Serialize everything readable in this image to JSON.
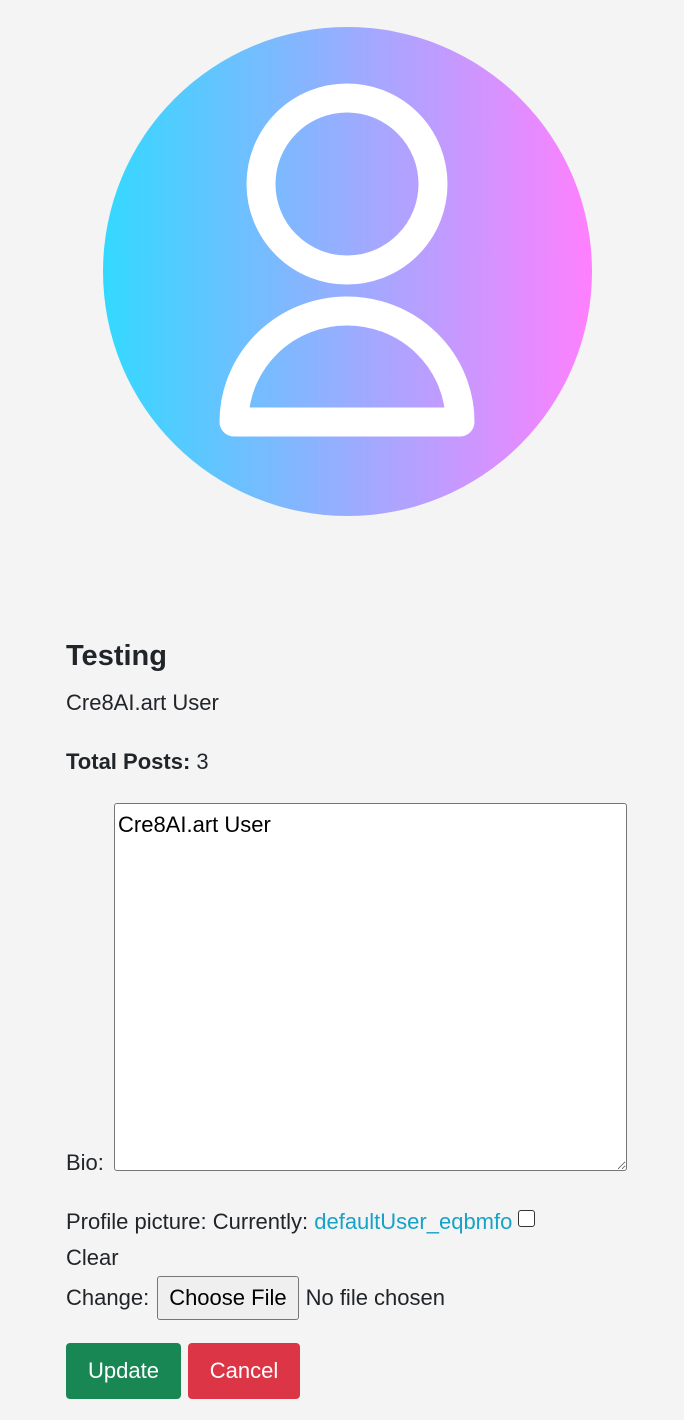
{
  "profile": {
    "username": "Testing",
    "subtitle": "Cre8AI.art User",
    "total_posts_label": "Total Posts:",
    "total_posts_value": "3",
    "avatar_icon": "user-silhouette-icon",
    "avatar_gradient": [
      "#33d9ff",
      "#ff80ff"
    ]
  },
  "form": {
    "bio_label": "Bio:",
    "bio_value": "Cre8AI.art User",
    "picture_label": "Profile picture:",
    "currently_label": "Currently:",
    "current_file": "defaultUser_eqbmfo",
    "clear_label": "Clear",
    "change_label": "Change:",
    "choose_file_label": "Choose File",
    "no_file_text": "No file chosen",
    "update_label": "Update",
    "cancel_label": "Cancel"
  },
  "colors": {
    "background": "#f4f4f4",
    "link": "#17a2c8",
    "update_button": "#198754",
    "cancel_button": "#dc3545"
  }
}
